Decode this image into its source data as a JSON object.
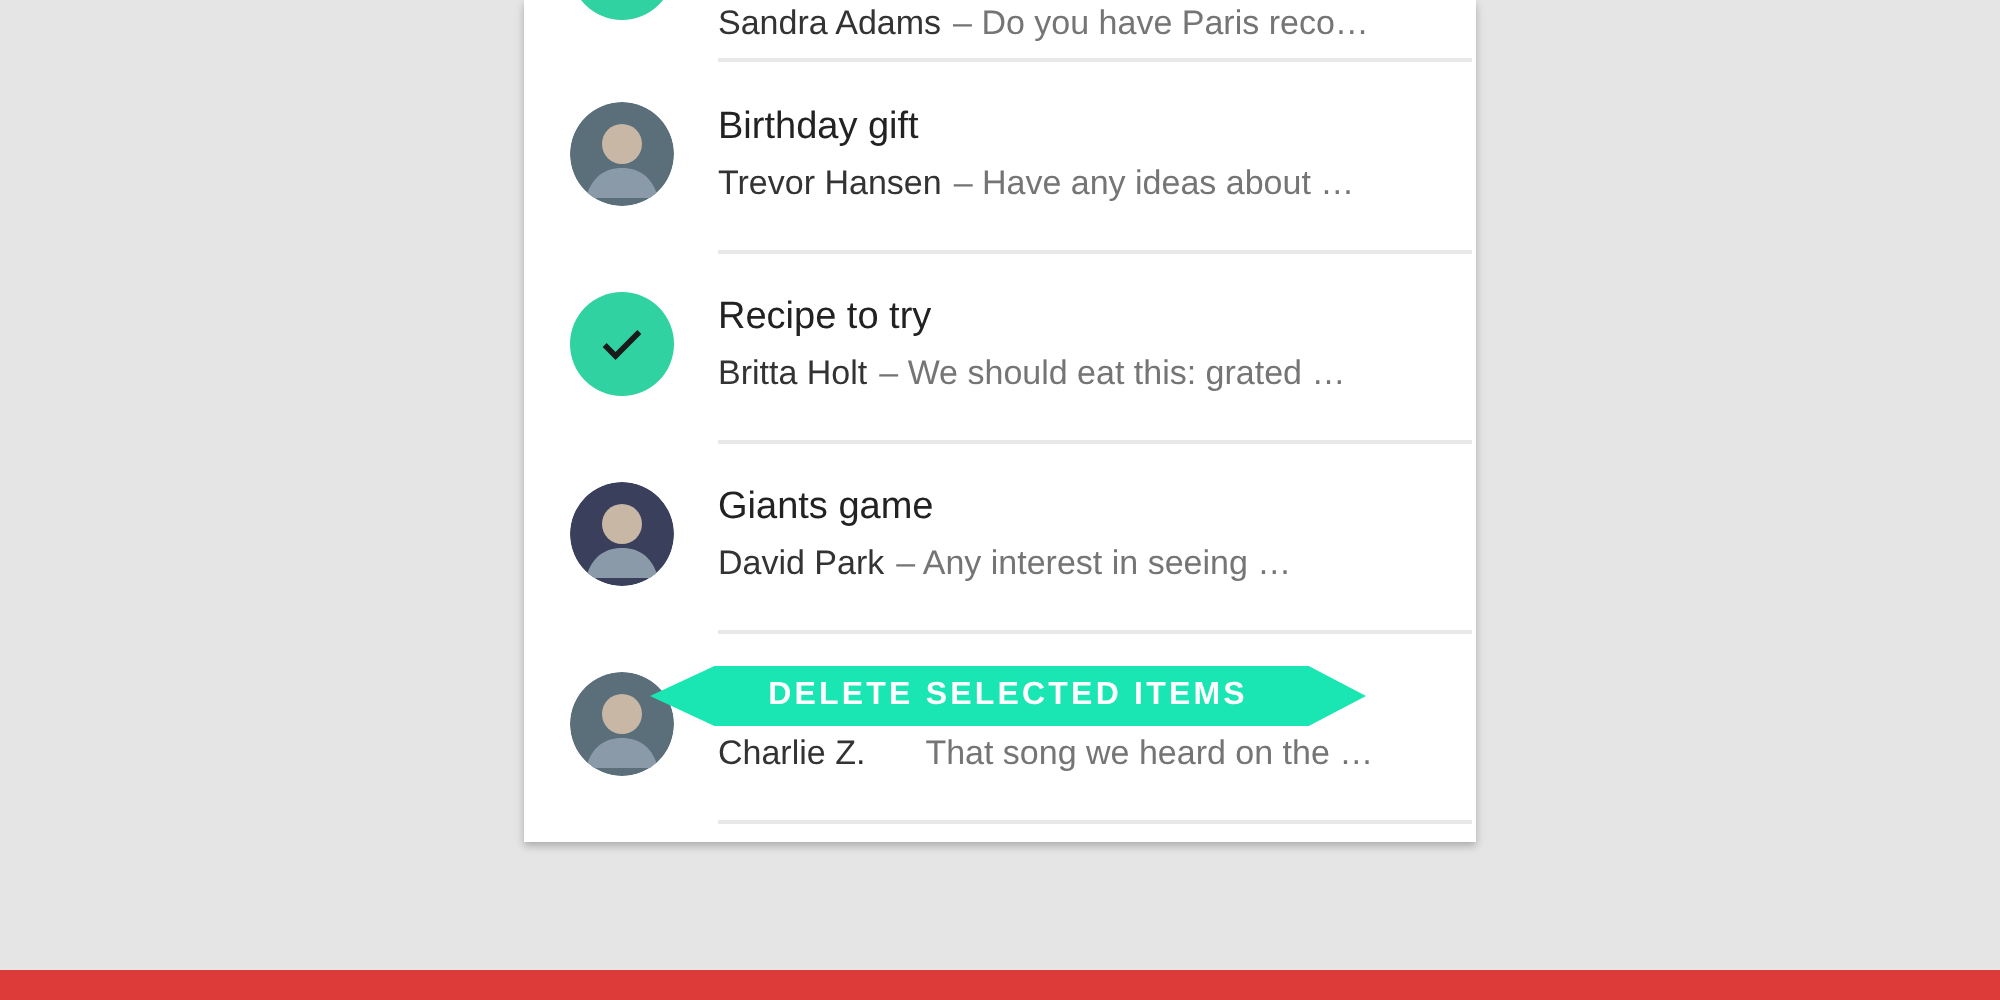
{
  "messages": [
    {
      "sender": "Sandra Adams",
      "preview": "– Do you have Paris reco…",
      "selected": true
    },
    {
      "subject": "Birthday gift",
      "sender": "Trevor Hansen",
      "preview": "– Have any ideas about  …",
      "selected": false
    },
    {
      "subject": "Recipe to try",
      "sender": "Britta Holt",
      "preview": "– We should eat this: grated …",
      "selected": true
    },
    {
      "subject": "Giants game",
      "sender": "David Park",
      "preview": "– Any interest in seeing …",
      "selected": false
    },
    {
      "sender": "Charlie Z.",
      "preview": "That song we heard on the …",
      "selected": false
    }
  ],
  "banner": {
    "label": "DELETE SELECTED ITEMS"
  }
}
